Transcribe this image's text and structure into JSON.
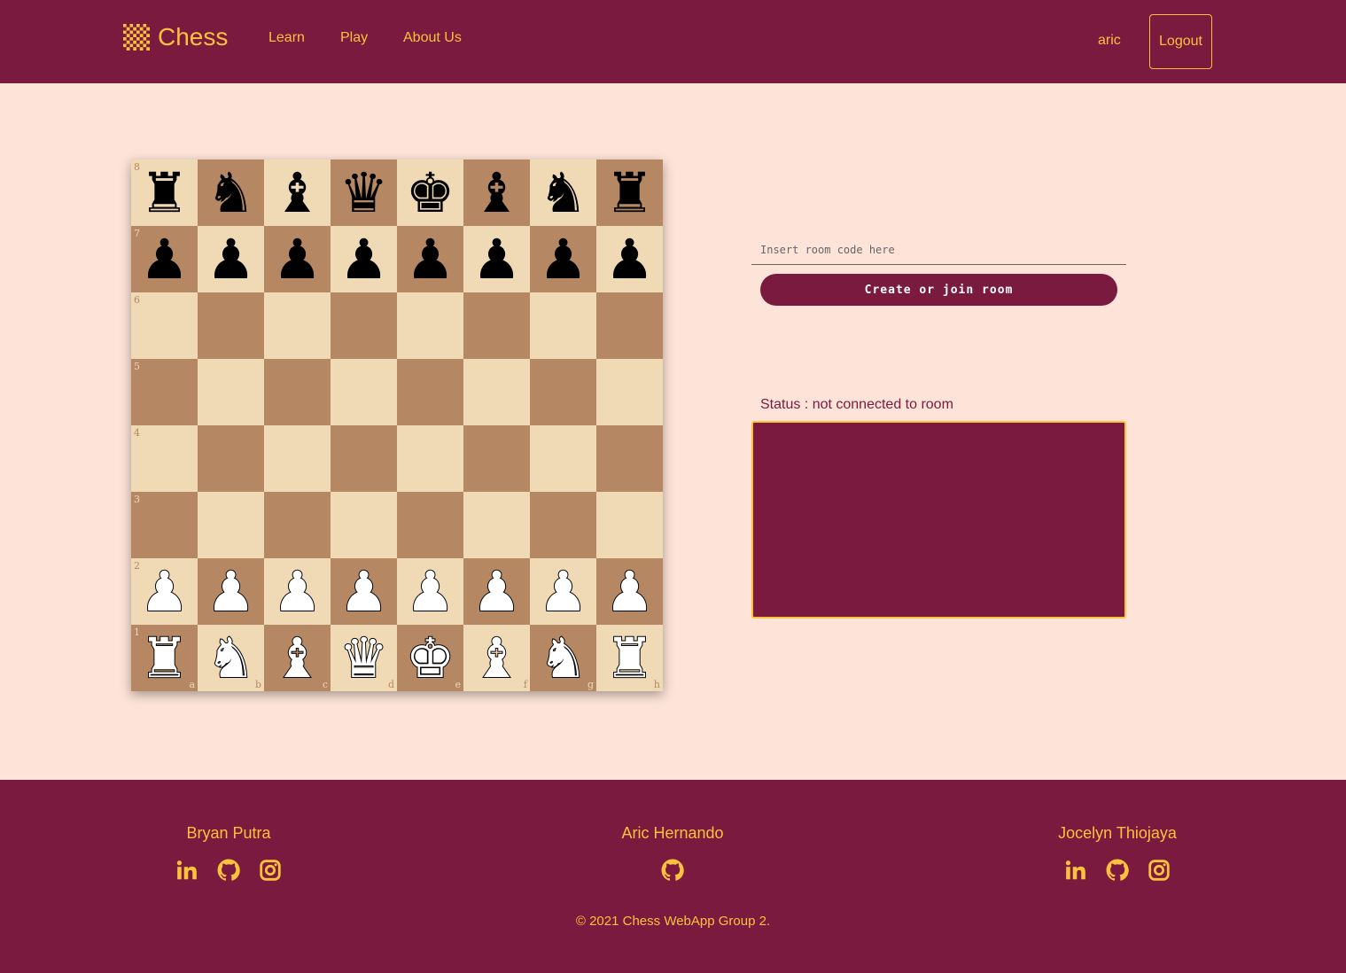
{
  "nav": {
    "brand": "Chess",
    "links": [
      "Learn",
      "Play",
      "About Us"
    ],
    "user": "aric",
    "logout": "Logout"
  },
  "board": {
    "ranks": [
      "8",
      "7",
      "6",
      "5",
      "4",
      "3",
      "2",
      "1"
    ],
    "files": [
      "a",
      "b",
      "c",
      "d",
      "e",
      "f",
      "g",
      "h"
    ],
    "position": [
      [
        "br",
        "bn",
        "bb",
        "bq",
        "bk",
        "bb",
        "bn",
        "br"
      ],
      [
        "bp",
        "bp",
        "bp",
        "bp",
        "bp",
        "bp",
        "bp",
        "bp"
      ],
      [
        "",
        "",
        "",
        "",
        "",
        "",
        "",
        ""
      ],
      [
        "",
        "",
        "",
        "",
        "",
        "",
        "",
        ""
      ],
      [
        "",
        "",
        "",
        "",
        "",
        "",
        "",
        ""
      ],
      [
        "",
        "",
        "",
        "",
        "",
        "",
        "",
        ""
      ],
      [
        "wp",
        "wp",
        "wp",
        "wp",
        "wp",
        "wp",
        "wp",
        "wp"
      ],
      [
        "wr",
        "wn",
        "wb",
        "wq",
        "wk",
        "wb",
        "wn",
        "wr"
      ]
    ]
  },
  "room": {
    "placeholder": "Insert room code here",
    "button": "Create or join room",
    "status": "Status : not connected to room"
  },
  "footer": {
    "members": [
      {
        "name": "Bryan Putra",
        "socials": [
          "linkedin-icon",
          "github-icon",
          "instagram-icon"
        ]
      },
      {
        "name": "Aric Hernando",
        "socials": [
          "github-icon"
        ]
      },
      {
        "name": "Jocelyn Thiojaya",
        "socials": [
          "linkedin-icon",
          "github-icon",
          "instagram-icon"
        ]
      }
    ],
    "copyright": "© 2021 Chess WebApp Group 2."
  },
  "colors": {
    "primary": "#7b1a3f",
    "accent": "#fcc13d",
    "background": "#fde3d8",
    "light_square": "#f0d9b5",
    "dark_square": "#b58863"
  }
}
